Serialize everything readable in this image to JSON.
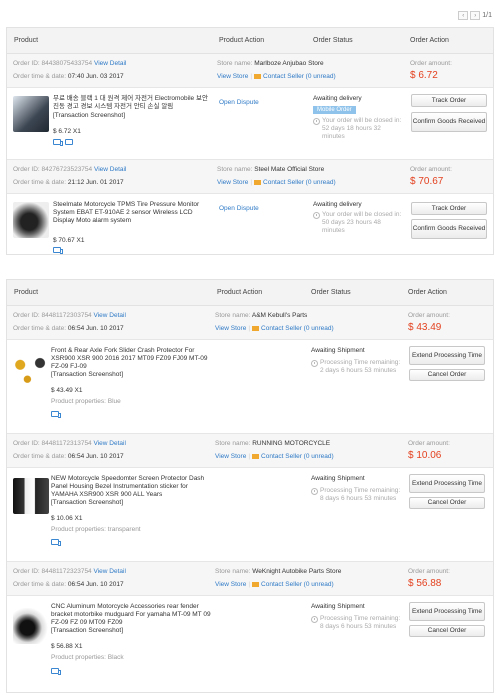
{
  "pager": {
    "prev": "‹",
    "next": "›",
    "text": "1/1"
  },
  "columns": {
    "product": "Product",
    "product_action": "Product Action",
    "order_status": "Order Status",
    "order_action": "Order Action"
  },
  "labels": {
    "order_id": "Order ID:",
    "order_time": "Order time & date:",
    "store_name": "Store name:",
    "view_detail": "View Detail",
    "view_store": "View Store",
    "contact_seller": "Contact Seller",
    "unread": "(0 unread)",
    "order_amount": "Order amount:",
    "transaction": "[Transaction Screenshot]",
    "product_properties": "Product properties:"
  },
  "group1": [
    {
      "order_id": "84438075433754",
      "time": "07:40 Jun. 03 2017",
      "store": "Marlboze Anjubao Store",
      "amount": "$ 6.72",
      "title": "무료 배송 블랙 1 대 원격 제어 자전거 Electromobile 보안 진동 경고 경보 시스템 자전거 안티 손실 알림",
      "price": "$ 6.72 X1",
      "action": "Open Dispute",
      "status": "Awaiting delivery",
      "badge": "Mobile Order",
      "timer": "Your order will be closed in: 52 days 18 hours 32 minutes",
      "btn1": "Track Order",
      "btn2": "Confirm Goods Received"
    },
    {
      "order_id": "84276723523754",
      "time": "21:12 Jun. 01 2017",
      "store": "Steel Mate Official Store",
      "amount": "$ 70.67",
      "title": "Steelmate Motorcycle TPMS Tire Pressure Monitor System EBAT ET-910AE 2 sensor Wireless LCD Display Moto alarm system",
      "price": "$ 70.67 X1",
      "action": "Open Dispute",
      "status": "Awaiting delivery",
      "timer": "Your order will be closed in: 50 days 23 hours 48 minutes",
      "btn1": "Track Order",
      "btn2": "Confirm Goods Received"
    }
  ],
  "group2": [
    {
      "order_id": "84481172303754",
      "time": "06:54 Jun. 10 2017",
      "store": "A&M Kebull's Parts",
      "amount": "$ 43.49",
      "title": "Front & Rear Axle Fork Slider Crash Protector For XSR900 XSR 900 2016 2017 MT09 FZ09 FJ09 MT-09 FZ-09 FJ-09",
      "price": "$ 43.49 X1",
      "props": "Blue",
      "status": "Awaiting Shipment",
      "timer": "Processing Time remaining: 2 days 6 hours 53 minutes",
      "btn1": "Extend Processing Time",
      "btn2": "Cancel Order"
    },
    {
      "order_id": "84481172313754",
      "time": "06:54 Jun. 10 2017",
      "store": "RUNNING MOTORCYCLE",
      "amount": "$ 10.06",
      "title": "NEW Motorcycle Speedomter Screen Protector Dash Panel Housing Bezel Instrumentation sticker for YAMAHA XSR900 XSR 900 ALL Years",
      "price": "$ 10.06 X1",
      "props": "transparent",
      "status": "Awaiting Shipment",
      "timer": "Processing Time remaining: 8 days 6 hours 53 minutes",
      "btn1": "Extend Processing Time",
      "btn2": "Cancel Order"
    },
    {
      "order_id": "84481172323754",
      "time": "06:54 Jun. 10 2017",
      "store": "WeKnight Autobike Parts Store",
      "amount": "$ 56.88",
      "title": "CNC Aluminum Motorcycle Accessories rear fender bracket motorbike mudguard For yamaha MT-09 MT 09 FZ-09 FZ 09 MT09 FZ09",
      "price": "$ 56.88 X1",
      "props": "Black",
      "status": "Awaiting Shipment",
      "timer": "Processing Time remaining: 8 days 6 hours 53 minutes",
      "btn1": "Extend Processing Time",
      "btn2": "Cancel Order"
    }
  ]
}
